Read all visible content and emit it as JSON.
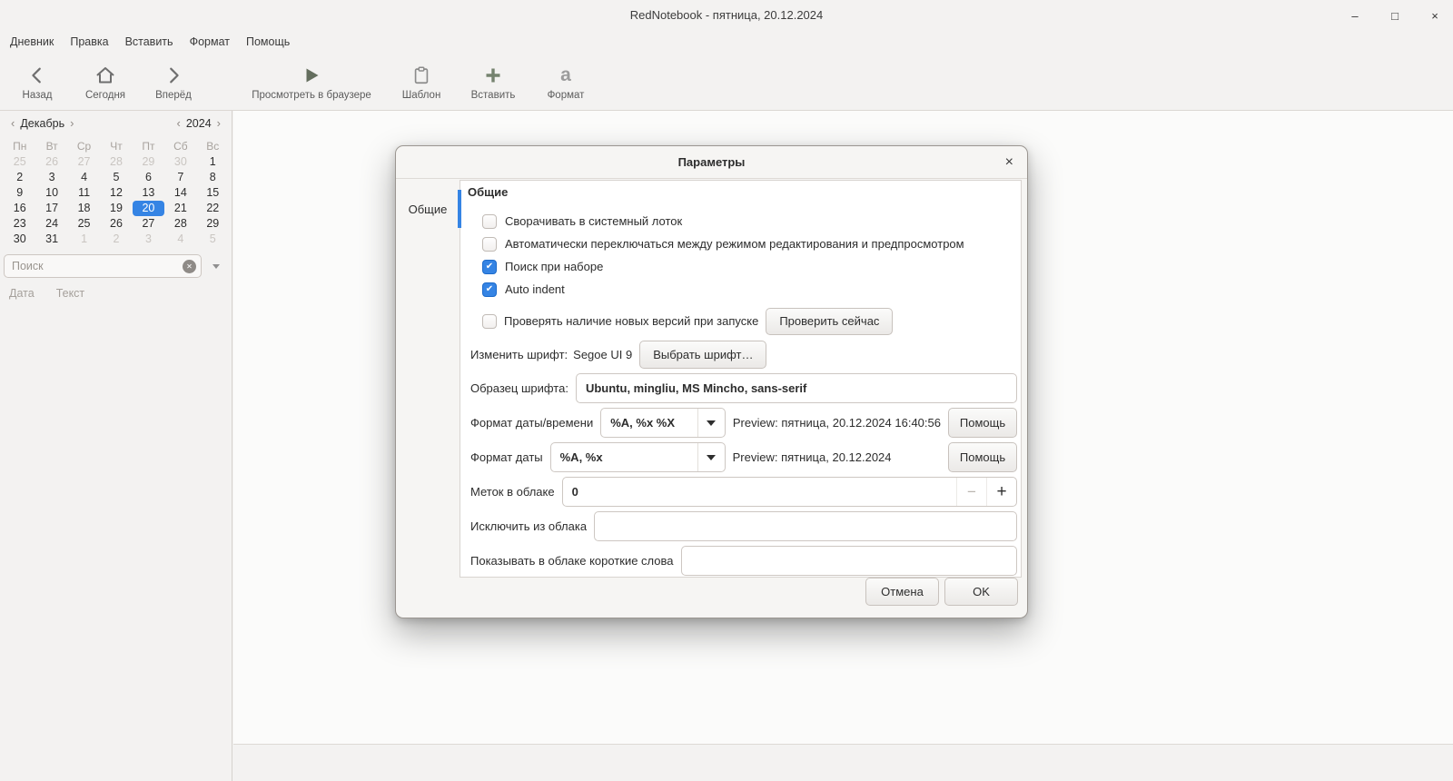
{
  "window": {
    "title": "RedNotebook - пятница, 20.12.2024"
  },
  "glyphs": {
    "minimize": "–",
    "maximize": "□",
    "close": "×",
    "chevron_left": "‹",
    "chevron_right": "›",
    "clear": "✕",
    "check": "✔",
    "minus": "−",
    "plus": "+",
    "format_a": "a"
  },
  "menubar": {
    "items": [
      "Дневник",
      "Правка",
      "Вставить",
      "Формат",
      "Помощь"
    ]
  },
  "toolbar": {
    "items": [
      {
        "label": "Назад"
      },
      {
        "label": "Сегодня"
      },
      {
        "label": "Вперёд"
      },
      {
        "label": "Просмотреть в браузере"
      },
      {
        "label": "Шаблон"
      },
      {
        "label": "Вставить"
      },
      {
        "label": "Формат"
      }
    ]
  },
  "calendar": {
    "month": "Декабрь",
    "year": "2024",
    "day_headers": [
      "Пн",
      "Вт",
      "Ср",
      "Чт",
      "Пт",
      "Сб",
      "Вс"
    ],
    "cells": [
      {
        "label": "25",
        "muted": true
      },
      {
        "label": "26",
        "muted": true
      },
      {
        "label": "27",
        "muted": true
      },
      {
        "label": "28",
        "muted": true
      },
      {
        "label": "29",
        "muted": true
      },
      {
        "label": "30",
        "muted": true
      },
      {
        "label": "1"
      },
      {
        "label": "2"
      },
      {
        "label": "3"
      },
      {
        "label": "4"
      },
      {
        "label": "5"
      },
      {
        "label": "6"
      },
      {
        "label": "7"
      },
      {
        "label": "8"
      },
      {
        "label": "9"
      },
      {
        "label": "10"
      },
      {
        "label": "11"
      },
      {
        "label": "12"
      },
      {
        "label": "13"
      },
      {
        "label": "14"
      },
      {
        "label": "15"
      },
      {
        "label": "16"
      },
      {
        "label": "17"
      },
      {
        "label": "18"
      },
      {
        "label": "19"
      },
      {
        "label": "20",
        "selected": true
      },
      {
        "label": "21"
      },
      {
        "label": "22"
      },
      {
        "label": "23"
      },
      {
        "label": "24"
      },
      {
        "label": "25"
      },
      {
        "label": "26"
      },
      {
        "label": "27"
      },
      {
        "label": "28"
      },
      {
        "label": "29"
      },
      {
        "label": "30"
      },
      {
        "label": "31"
      },
      {
        "label": "1",
        "muted": true
      },
      {
        "label": "2",
        "muted": true
      },
      {
        "label": "3",
        "muted": true
      },
      {
        "label": "4",
        "muted": true
      },
      {
        "label": "5",
        "muted": true
      }
    ]
  },
  "search": {
    "placeholder": "Поиск"
  },
  "results": {
    "columns": [
      "Дата",
      "Текст"
    ]
  },
  "dialog": {
    "title": "Параметры",
    "tab": "Общие",
    "section_title": "Общие",
    "checkboxes": [
      {
        "label": "Сворачивать в системный лоток",
        "checked": false
      },
      {
        "label": "Автоматически переключаться между режимом редактирования и предпросмотром",
        "checked": false
      },
      {
        "label": "Поиск при наборе",
        "checked": true
      },
      {
        "label": "Auto indent",
        "checked": true
      }
    ],
    "version_check": {
      "label": "Проверять наличие новых версий при запуске",
      "checked": false,
      "button": "Проверить сейчас"
    },
    "font": {
      "label": "Изменить шрифт:",
      "value": "Segoe UI 9",
      "button": "Выбрать шрифт…"
    },
    "font_sample": {
      "label": "Образец шрифта:",
      "value": "Ubuntu, mingliu, MS Mincho, sans-serif"
    },
    "datetime_format": {
      "label": "Формат даты/времени",
      "value": "%A, %x %X",
      "preview": "Preview: пятница, 20.12.2024 16:40:56",
      "help": "Помощь"
    },
    "date_format": {
      "label": "Формат даты",
      "value": "%A, %x",
      "preview": "Preview: пятница, 20.12.2024",
      "help": "Помощь"
    },
    "tags_cloud": {
      "label": "Меток в облаке",
      "value": "0"
    },
    "exclude_cloud": {
      "label": "Исключить из облака",
      "value": ""
    },
    "short_words": {
      "label": "Показывать в облаке короткие слова",
      "value": ""
    },
    "cancel": "Отмена",
    "ok": "OK"
  },
  "colors": {
    "accent": "#3584e4"
  }
}
